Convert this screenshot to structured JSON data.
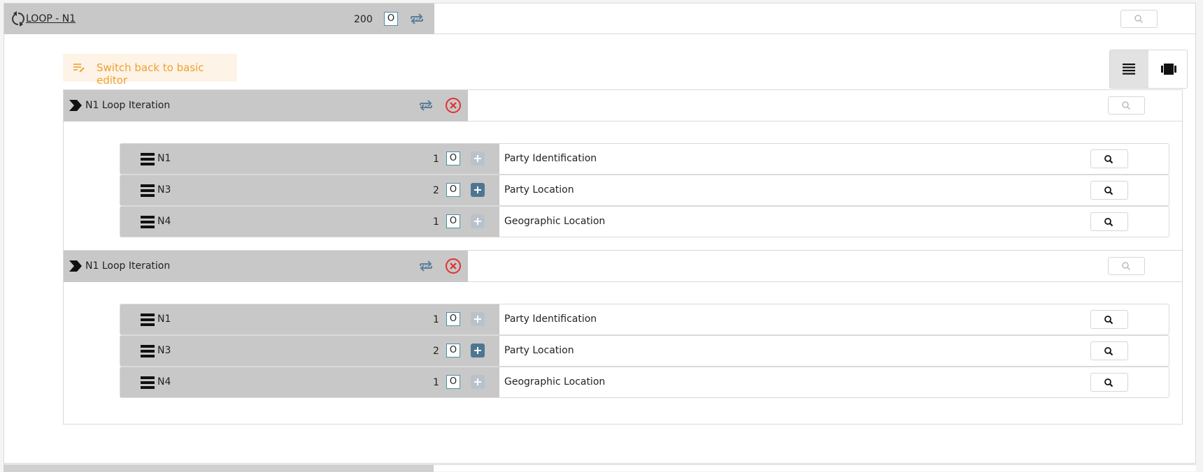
{
  "loop": {
    "title": "LOOP - N1",
    "count": "200",
    "badge": "O",
    "icon": "loop-arrows-icon"
  },
  "switch_editor": {
    "label": "Switch back to basic editor",
    "icon": "edit-lines-icon",
    "color": "#f0a030"
  },
  "view_toggle": {
    "options": [
      "list-view-icon",
      "card-view-icon"
    ],
    "active": 0
  },
  "iterations": [
    {
      "title": "N1 Loop Iteration",
      "segments": [
        {
          "id": "N1",
          "count": "1",
          "badge": "O",
          "add_enabled": false,
          "name": "Party Identification"
        },
        {
          "id": "N3",
          "count": "2",
          "badge": "O",
          "add_enabled": true,
          "name": "Party Location"
        },
        {
          "id": "N4",
          "count": "1",
          "badge": "O",
          "add_enabled": false,
          "name": "Geographic Location"
        }
      ]
    },
    {
      "title": "N1 Loop Iteration",
      "segments": [
        {
          "id": "N1",
          "count": "1",
          "badge": "O",
          "add_enabled": false,
          "name": "Party Identification"
        },
        {
          "id": "N3",
          "count": "2",
          "badge": "O",
          "add_enabled": true,
          "name": "Party Location"
        },
        {
          "id": "N4",
          "count": "1",
          "badge": "O",
          "add_enabled": false,
          "name": "Geographic Location"
        }
      ]
    }
  ],
  "colors": {
    "header_gray": "#c8c8c8",
    "accent_blue": "#4e7693",
    "remove_red": "#e03131",
    "badge_border": "#4d8fa6"
  }
}
